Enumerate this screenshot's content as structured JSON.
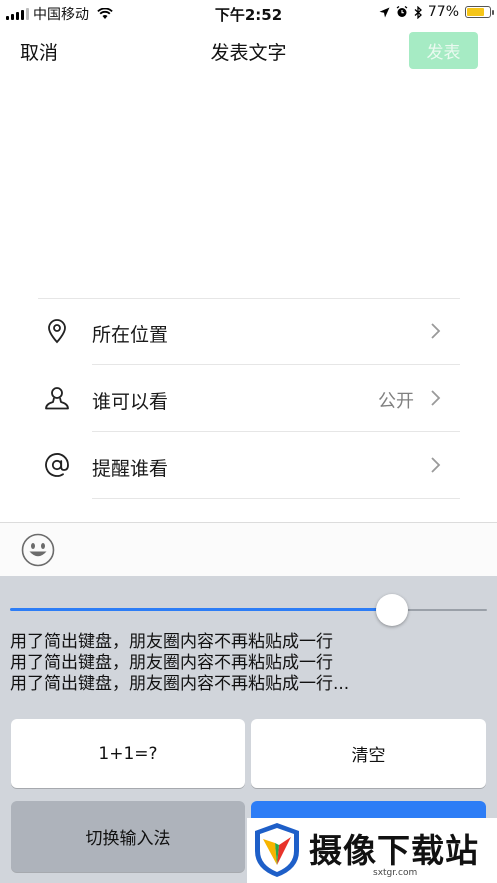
{
  "status_bar": {
    "carrier": "中国移动",
    "time": "下午2:52",
    "battery_percent": "77%",
    "battery_level": 0.77
  },
  "nav": {
    "cancel_label": "取消",
    "title": "发表文字",
    "publish_label": "发表"
  },
  "options": [
    {
      "label": "所在位置",
      "value": "",
      "icon": "location-pin-icon"
    },
    {
      "label": "谁可以看",
      "value": "公开",
      "icon": "person-icon"
    },
    {
      "label": "提醒谁看",
      "value": "",
      "icon": "at-sign-icon"
    }
  ],
  "keyboard": {
    "slider_value": 0.8,
    "clipboard_lines": [
      "用了简出键盘，朋友圈内容不再粘贴成一行",
      "用了简出键盘，朋友圈内容不再粘贴成一行",
      "用了简出键盘，朋友圈内容不再粘贴成一行..."
    ],
    "calc_key_label": "1+1=?",
    "clear_key_label": "清空",
    "switch_key_label": "切换输入法",
    "accent_color": "#2d7df6"
  },
  "watermark": {
    "brand": "摄像下载站",
    "url": "sxtgr.com"
  },
  "colors": {
    "publish_bg": "#a6ebc4",
    "keyboard_bg": "#d1d5db"
  }
}
